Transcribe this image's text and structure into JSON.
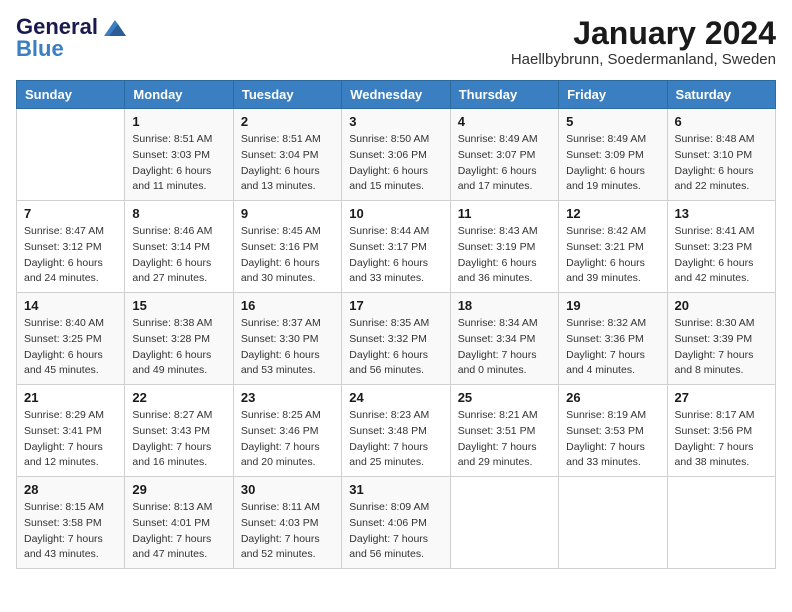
{
  "logo": {
    "line1": "General",
    "line2": "Blue"
  },
  "title": "January 2024",
  "subtitle": "Haellbybrunn, Soedermanland, Sweden",
  "days_of_week": [
    "Sunday",
    "Monday",
    "Tuesday",
    "Wednesday",
    "Thursday",
    "Friday",
    "Saturday"
  ],
  "weeks": [
    [
      {
        "day": "",
        "info": ""
      },
      {
        "day": "1",
        "info": "Sunrise: 8:51 AM\nSunset: 3:03 PM\nDaylight: 6 hours\nand 11 minutes."
      },
      {
        "day": "2",
        "info": "Sunrise: 8:51 AM\nSunset: 3:04 PM\nDaylight: 6 hours\nand 13 minutes."
      },
      {
        "day": "3",
        "info": "Sunrise: 8:50 AM\nSunset: 3:06 PM\nDaylight: 6 hours\nand 15 minutes."
      },
      {
        "day": "4",
        "info": "Sunrise: 8:49 AM\nSunset: 3:07 PM\nDaylight: 6 hours\nand 17 minutes."
      },
      {
        "day": "5",
        "info": "Sunrise: 8:49 AM\nSunset: 3:09 PM\nDaylight: 6 hours\nand 19 minutes."
      },
      {
        "day": "6",
        "info": "Sunrise: 8:48 AM\nSunset: 3:10 PM\nDaylight: 6 hours\nand 22 minutes."
      }
    ],
    [
      {
        "day": "7",
        "info": "Sunrise: 8:47 AM\nSunset: 3:12 PM\nDaylight: 6 hours\nand 24 minutes."
      },
      {
        "day": "8",
        "info": "Sunrise: 8:46 AM\nSunset: 3:14 PM\nDaylight: 6 hours\nand 27 minutes."
      },
      {
        "day": "9",
        "info": "Sunrise: 8:45 AM\nSunset: 3:16 PM\nDaylight: 6 hours\nand 30 minutes."
      },
      {
        "day": "10",
        "info": "Sunrise: 8:44 AM\nSunset: 3:17 PM\nDaylight: 6 hours\nand 33 minutes."
      },
      {
        "day": "11",
        "info": "Sunrise: 8:43 AM\nSunset: 3:19 PM\nDaylight: 6 hours\nand 36 minutes."
      },
      {
        "day": "12",
        "info": "Sunrise: 8:42 AM\nSunset: 3:21 PM\nDaylight: 6 hours\nand 39 minutes."
      },
      {
        "day": "13",
        "info": "Sunrise: 8:41 AM\nSunset: 3:23 PM\nDaylight: 6 hours\nand 42 minutes."
      }
    ],
    [
      {
        "day": "14",
        "info": "Sunrise: 8:40 AM\nSunset: 3:25 PM\nDaylight: 6 hours\nand 45 minutes."
      },
      {
        "day": "15",
        "info": "Sunrise: 8:38 AM\nSunset: 3:28 PM\nDaylight: 6 hours\nand 49 minutes."
      },
      {
        "day": "16",
        "info": "Sunrise: 8:37 AM\nSunset: 3:30 PM\nDaylight: 6 hours\nand 53 minutes."
      },
      {
        "day": "17",
        "info": "Sunrise: 8:35 AM\nSunset: 3:32 PM\nDaylight: 6 hours\nand 56 minutes."
      },
      {
        "day": "18",
        "info": "Sunrise: 8:34 AM\nSunset: 3:34 PM\nDaylight: 7 hours\nand 0 minutes."
      },
      {
        "day": "19",
        "info": "Sunrise: 8:32 AM\nSunset: 3:36 PM\nDaylight: 7 hours\nand 4 minutes."
      },
      {
        "day": "20",
        "info": "Sunrise: 8:30 AM\nSunset: 3:39 PM\nDaylight: 7 hours\nand 8 minutes."
      }
    ],
    [
      {
        "day": "21",
        "info": "Sunrise: 8:29 AM\nSunset: 3:41 PM\nDaylight: 7 hours\nand 12 minutes."
      },
      {
        "day": "22",
        "info": "Sunrise: 8:27 AM\nSunset: 3:43 PM\nDaylight: 7 hours\nand 16 minutes."
      },
      {
        "day": "23",
        "info": "Sunrise: 8:25 AM\nSunset: 3:46 PM\nDaylight: 7 hours\nand 20 minutes."
      },
      {
        "day": "24",
        "info": "Sunrise: 8:23 AM\nSunset: 3:48 PM\nDaylight: 7 hours\nand 25 minutes."
      },
      {
        "day": "25",
        "info": "Sunrise: 8:21 AM\nSunset: 3:51 PM\nDaylight: 7 hours\nand 29 minutes."
      },
      {
        "day": "26",
        "info": "Sunrise: 8:19 AM\nSunset: 3:53 PM\nDaylight: 7 hours\nand 33 minutes."
      },
      {
        "day": "27",
        "info": "Sunrise: 8:17 AM\nSunset: 3:56 PM\nDaylight: 7 hours\nand 38 minutes."
      }
    ],
    [
      {
        "day": "28",
        "info": "Sunrise: 8:15 AM\nSunset: 3:58 PM\nDaylight: 7 hours\nand 43 minutes."
      },
      {
        "day": "29",
        "info": "Sunrise: 8:13 AM\nSunset: 4:01 PM\nDaylight: 7 hours\nand 47 minutes."
      },
      {
        "day": "30",
        "info": "Sunrise: 8:11 AM\nSunset: 4:03 PM\nDaylight: 7 hours\nand 52 minutes."
      },
      {
        "day": "31",
        "info": "Sunrise: 8:09 AM\nSunset: 4:06 PM\nDaylight: 7 hours\nand 56 minutes."
      },
      {
        "day": "",
        "info": ""
      },
      {
        "day": "",
        "info": ""
      },
      {
        "day": "",
        "info": ""
      }
    ]
  ]
}
